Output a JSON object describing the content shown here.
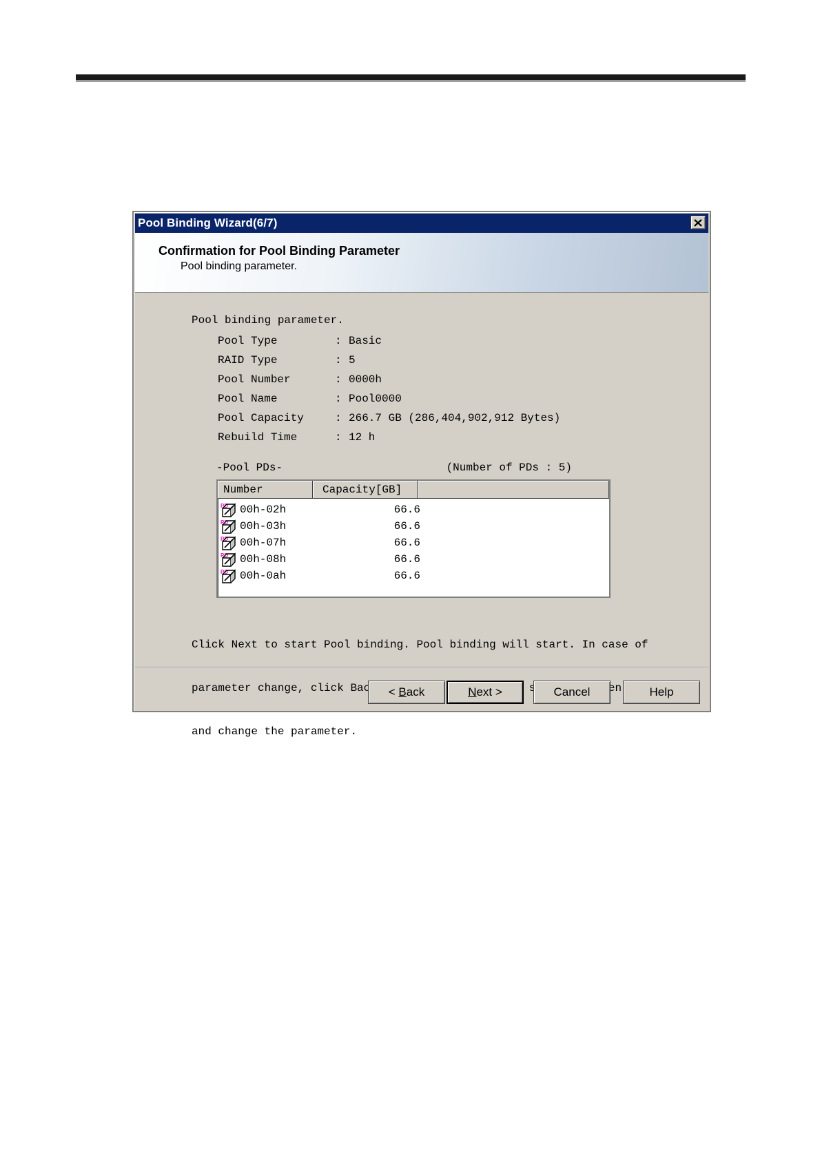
{
  "window": {
    "title": "Pool Binding Wizard(6/7)"
  },
  "banner": {
    "title": "Confirmation for Pool Binding Parameter",
    "subtitle": "Pool binding parameter."
  },
  "section": {
    "heading": "Pool binding parameter.",
    "params": [
      {
        "label": "Pool Type",
        "value": "Basic"
      },
      {
        "label": "RAID Type",
        "value": "5"
      },
      {
        "label": "Pool Number",
        "value": "0000h"
      },
      {
        "label": "Pool Name",
        "value": "Pool0000"
      },
      {
        "label": "Pool Capacity",
        "value": "266.7 GB (286,404,902,912 Bytes)"
      },
      {
        "label": "Rebuild Time",
        "value": "12 h"
      }
    ],
    "colon": ":"
  },
  "pool_pds": {
    "label": "-Pool PDs-",
    "count_text": "(Number of PDs : 5)",
    "columns": [
      "Number",
      "Capacity[GB]"
    ],
    "icon": "pd-drive-icon",
    "rows": [
      {
        "number": "00h-02h",
        "capacity": "66.6"
      },
      {
        "number": "00h-03h",
        "capacity": "66.6"
      },
      {
        "number": "00h-07h",
        "capacity": "66.6"
      },
      {
        "number": "00h-08h",
        "capacity": "66.6"
      },
      {
        "number": "00h-0ah",
        "capacity": "66.6"
      }
    ]
  },
  "description": {
    "lines": [
      "Click Next to start Pool binding. Pool binding will start. In case of",
      "parameter change, click Back to return to suitable setting screen,",
      "and change the parameter."
    ]
  },
  "buttons": {
    "back": {
      "pre": "< ",
      "mnemonic": "B",
      "rest": "ack"
    },
    "next": {
      "mnemonic": "N",
      "rest": "ext",
      "post": " >"
    },
    "cancel": "Cancel",
    "help": "Help"
  },
  "colors": {
    "titlebar": "#0a246a",
    "dialog_face": "#d4d0c8",
    "pd_icon_magenta": "#e020c0"
  }
}
